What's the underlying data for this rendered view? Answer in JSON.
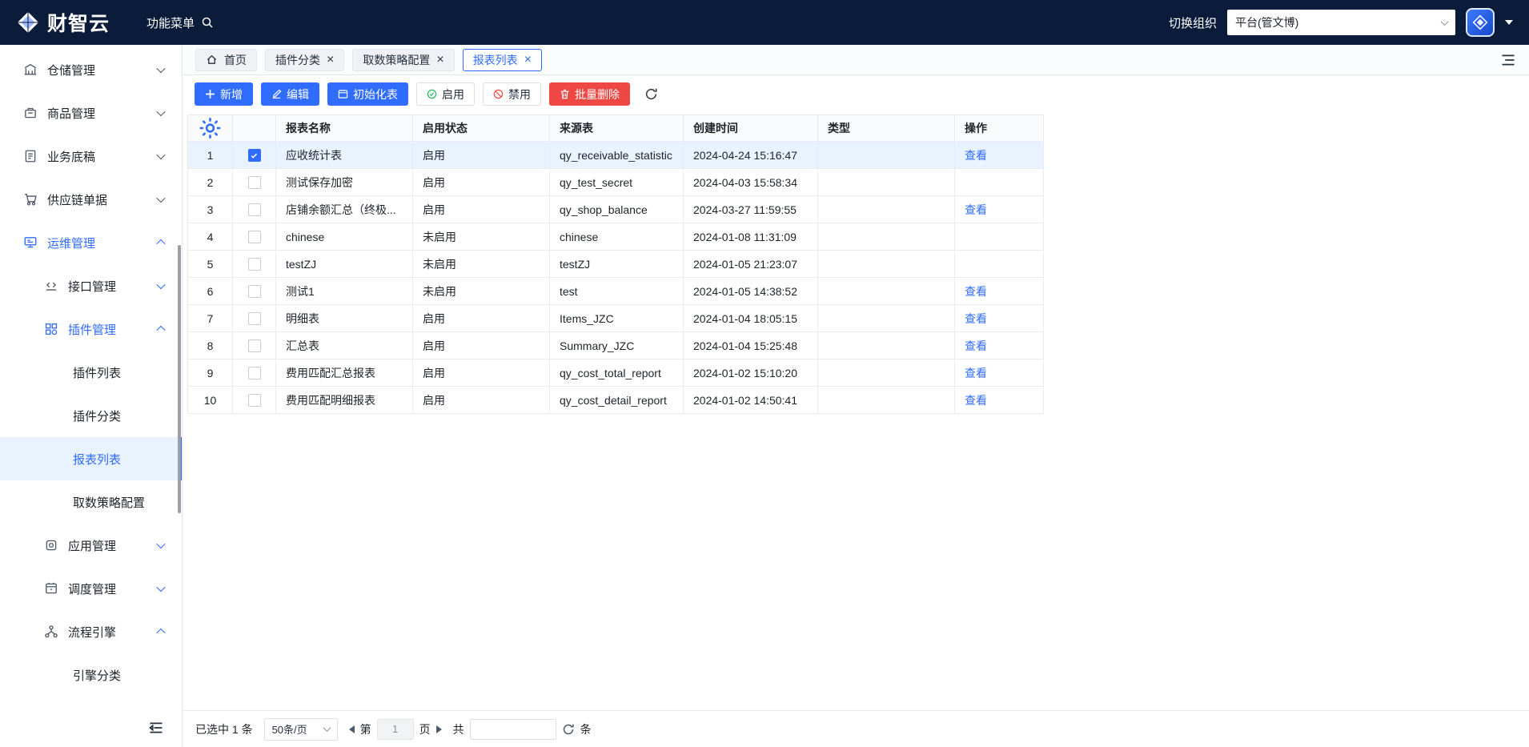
{
  "colors": {
    "header_bg": "#0a1c39",
    "accent": "#2f6cff",
    "danger": "#ef4743",
    "success": "#23b45d",
    "selected_row_bg": "#e9f2ff"
  },
  "header": {
    "brand": "财智云",
    "menu_label": "功能菜单",
    "org_switch_label": "切换组织",
    "org_select_value": "平台(管文博)"
  },
  "sidebar": {
    "items": [
      {
        "label": "仓储管理",
        "level": 0,
        "icon": "bank",
        "chevron": "down",
        "chevron_blue": false,
        "active": false,
        "selected": false
      },
      {
        "label": "商品管理",
        "level": 0,
        "icon": "goods",
        "chevron": "down",
        "chevron_blue": false,
        "active": false,
        "selected": false
      },
      {
        "label": "业务底稿",
        "level": 0,
        "icon": "draft",
        "chevron": "down",
        "chevron_blue": false,
        "active": false,
        "selected": false
      },
      {
        "label": "供应链单据",
        "level": 0,
        "icon": "supply",
        "chevron": "down",
        "chevron_blue": false,
        "active": false,
        "selected": false
      },
      {
        "label": "运维管理",
        "level": 0,
        "icon": "ops",
        "chevron": "up",
        "chevron_blue": true,
        "active": true,
        "selected": false
      },
      {
        "label": "接口管理",
        "level": 1,
        "icon": "api",
        "chevron": "down",
        "chevron_blue": true,
        "active": false,
        "selected": false
      },
      {
        "label": "插件管理",
        "level": 1,
        "icon": "plugin",
        "chevron": "up",
        "chevron_blue": true,
        "active": true,
        "selected": false
      },
      {
        "label": "插件列表",
        "level": 2,
        "icon": null,
        "chevron": null,
        "chevron_blue": false,
        "active": false,
        "selected": false
      },
      {
        "label": "插件分类",
        "level": 2,
        "icon": null,
        "chevron": null,
        "chevron_blue": false,
        "active": false,
        "selected": false
      },
      {
        "label": "报表列表",
        "level": 2,
        "icon": null,
        "chevron": null,
        "chevron_blue": false,
        "active": false,
        "selected": true
      },
      {
        "label": "取数策略配置",
        "level": 2,
        "icon": null,
        "chevron": null,
        "chevron_blue": false,
        "active": false,
        "selected": false
      },
      {
        "label": "应用管理",
        "level": 1,
        "icon": "app",
        "chevron": "down",
        "chevron_blue": true,
        "active": false,
        "selected": false
      },
      {
        "label": "调度管理",
        "level": 1,
        "icon": "schedule",
        "chevron": "down",
        "chevron_blue": true,
        "active": false,
        "selected": false
      },
      {
        "label": "流程引擎",
        "level": 1,
        "icon": "flow",
        "chevron": "up",
        "chevron_blue": true,
        "active": false,
        "selected": false
      },
      {
        "label": "引擎分类",
        "level": 2,
        "icon": null,
        "chevron": null,
        "chevron_blue": false,
        "active": false,
        "selected": false
      }
    ]
  },
  "tabs": [
    {
      "label": "首页",
      "icon": "home",
      "closable": false,
      "active": false
    },
    {
      "label": "插件分类",
      "icon": null,
      "closable": true,
      "active": false
    },
    {
      "label": "取数策略配置",
      "icon": null,
      "closable": true,
      "active": false
    },
    {
      "label": "报表列表",
      "icon": null,
      "closable": true,
      "active": true
    }
  ],
  "toolbar": {
    "buttons": [
      {
        "label": "新增",
        "style": "primary",
        "icon": "plus"
      },
      {
        "label": "编辑",
        "style": "primary",
        "icon": "edit"
      },
      {
        "label": "初始化表",
        "style": "primary",
        "icon": "init"
      },
      {
        "label": "启用",
        "style": "default",
        "icon": "check"
      },
      {
        "label": "禁用",
        "style": "default",
        "icon": "ban"
      },
      {
        "label": "批量删除",
        "style": "danger",
        "icon": "trash"
      }
    ]
  },
  "table": {
    "columns": [
      "报表名称",
      "启用状态",
      "来源表",
      "创建时间",
      "类型",
      "操作"
    ],
    "view_label": "查看",
    "rows": [
      {
        "index": 1,
        "checked": true,
        "selected": true,
        "name": "应收统计表",
        "status": "启用",
        "source": "qy_receivable_statistic",
        "created": "2024-04-24 15:16:47",
        "type": "",
        "action": "查看"
      },
      {
        "index": 2,
        "checked": false,
        "selected": false,
        "name": "测试保存加密",
        "status": "启用",
        "source": "qy_test_secret",
        "created": "2024-04-03 15:58:34",
        "type": "",
        "action": ""
      },
      {
        "index": 3,
        "checked": false,
        "selected": false,
        "name": "店铺余额汇总（终极...",
        "status": "启用",
        "source": "qy_shop_balance",
        "created": "2024-03-27 11:59:55",
        "type": "",
        "action": "查看"
      },
      {
        "index": 4,
        "checked": false,
        "selected": false,
        "name": "chinese",
        "status": "未启用",
        "source": "chinese",
        "created": "2024-01-08 11:31:09",
        "type": "",
        "action": ""
      },
      {
        "index": 5,
        "checked": false,
        "selected": false,
        "name": "testZJ",
        "status": "未启用",
        "source": "testZJ",
        "created": "2024-01-05 21:23:07",
        "type": "",
        "action": ""
      },
      {
        "index": 6,
        "checked": false,
        "selected": false,
        "name": "测试1",
        "status": "未启用",
        "source": "test",
        "created": "2024-01-05 14:38:52",
        "type": "",
        "action": "查看"
      },
      {
        "index": 7,
        "checked": false,
        "selected": false,
        "name": "明细表",
        "status": "启用",
        "source": "Items_JZC",
        "created": "2024-01-04 18:05:15",
        "type": "",
        "action": "查看"
      },
      {
        "index": 8,
        "checked": false,
        "selected": false,
        "name": "汇总表",
        "status": "启用",
        "source": "Summary_JZC",
        "created": "2024-01-04 15:25:48",
        "type": "",
        "action": "查看"
      },
      {
        "index": 9,
        "checked": false,
        "selected": false,
        "name": "费用匹配汇总报表",
        "status": "启用",
        "source": "qy_cost_total_report",
        "created": "2024-01-02 15:10:20",
        "type": "",
        "action": "查看"
      },
      {
        "index": 10,
        "checked": false,
        "selected": false,
        "name": "费用匹配明细报表",
        "status": "启用",
        "source": "qy_cost_detail_report",
        "created": "2024-01-02 14:50:41",
        "type": "",
        "action": "查看"
      }
    ]
  },
  "pagination": {
    "selected_text": "已选中 1 条",
    "page_size": "50条/页",
    "page_prefix": "第",
    "page_value": "1",
    "page_suffix": "页",
    "total_prefix": "共",
    "total_value": "",
    "total_suffix": "条"
  }
}
